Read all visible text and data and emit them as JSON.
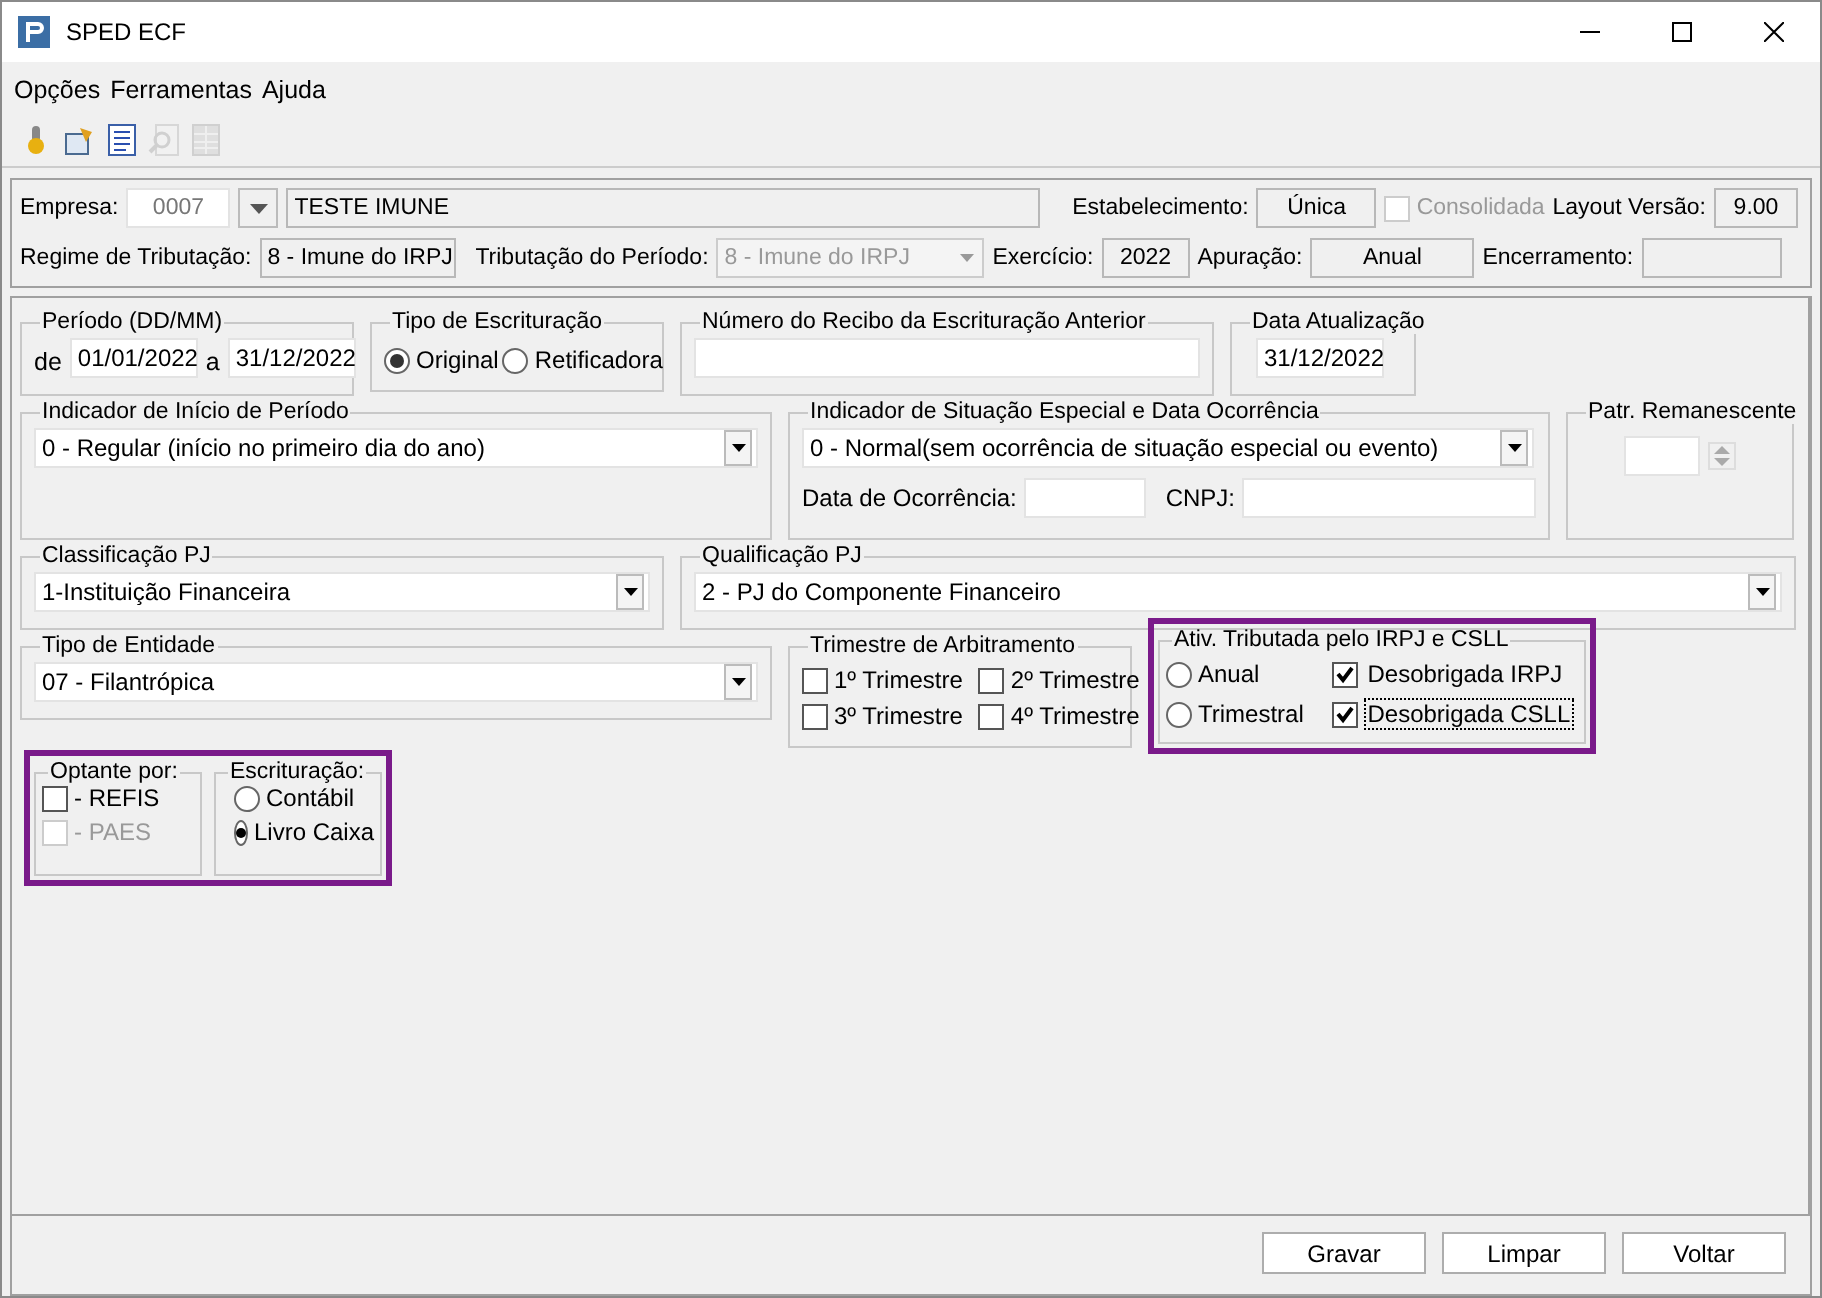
{
  "window": {
    "title": "SPED ECF"
  },
  "menu": [
    {
      "label": "Opções"
    },
    {
      "label": "Ferramentas"
    },
    {
      "label": "Ajuda"
    }
  ],
  "toolbar": [
    {
      "disabled": false
    },
    {
      "disabled": false
    },
    {
      "disabled": false
    },
    {
      "disabled": true
    },
    {
      "disabled": true
    }
  ],
  "header": {
    "empresa_label": "Empresa:",
    "empresa_code": "0007",
    "empresa_name": "TESTE IMUNE",
    "estabelecimento_label": "Estabelecimento:",
    "estabelecimento": "Única",
    "consolidada": {
      "label": "Consolidada",
      "checked": false,
      "disabled": true
    },
    "layout_label": "Layout Versão:",
    "layout": "9.00",
    "regime_label": "Regime de Tributação:",
    "regime": "8 - Imune do IRPJ",
    "tributacao_label": "Tributação do Período:",
    "tributacao": {
      "value": "8 - Imune do IRPJ",
      "disabled": true
    },
    "exercicio_label": "Exercício:",
    "exercicio": "2022",
    "apuracao_label": "Apuração:",
    "apuracao": "Anual",
    "encerramento_label": "Encerramento:"
  },
  "periodo": {
    "title": "Período (DD/MM)",
    "from_label": "de",
    "from": "01/01/2022",
    "to_label": "a",
    "to": "31/12/2022"
  },
  "tipo_escrituracao": {
    "title": "Tipo de Escrituração",
    "options": [
      {
        "label": "Original",
        "selected": true
      },
      {
        "label": "Retificadora",
        "selected": false
      }
    ]
  },
  "recibo": {
    "title": "Número do Recibo da Escrituração Anterior"
  },
  "data_atualizacao": {
    "title": "Data Atualização",
    "value": "31/12/2022"
  },
  "indicador_inicio": {
    "title": "Indicador de Início de Período",
    "value": "0 - Regular (início no primeiro dia do ano)"
  },
  "situacao_especial": {
    "title": "Indicador de Situação Especial e Data Ocorrência",
    "value": "0 - Normal(sem ocorrência de situação especial ou evento)",
    "data_label": "Data de Ocorrência:",
    "cnpj_label": "CNPJ:"
  },
  "patr": {
    "title": "Patr. Remanescente"
  },
  "classificacao": {
    "title": "Classificação PJ",
    "value": "1-Instituição Financeira"
  },
  "qualificacao": {
    "title": "Qualificação PJ",
    "value": "2 - PJ do Componente Financeiro"
  },
  "tipo_entidade": {
    "title": "Tipo de Entidade",
    "value": "07 - Filantrópica"
  },
  "trimestre": {
    "title": "Trimestre de Arbitramento",
    "options": [
      {
        "label": "1º Trimestre",
        "checked": false
      },
      {
        "label": "2º Trimestre",
        "checked": false
      },
      {
        "label": "3º Trimestre",
        "checked": false
      },
      {
        "label": "4º Trimestre",
        "checked": false
      }
    ]
  },
  "ativ": {
    "title": "Ativ. Tributada pelo IRPJ e CSLL",
    "highlighted": true,
    "periods": [
      {
        "label": "Anual",
        "selected": false
      },
      {
        "label": "Trimestral",
        "selected": false
      }
    ],
    "flags": [
      {
        "label": "Desobrigada IRPJ",
        "checked": true,
        "focused": false
      },
      {
        "label": "Desobrigada CSLL",
        "checked": true,
        "focused": true
      }
    ]
  },
  "opcoes": {
    "highlighted": true,
    "optante": {
      "title": "Optante por:",
      "items": [
        {
          "label": "- REFIS",
          "checked": false,
          "disabled": false
        },
        {
          "label": "- PAES",
          "checked": false,
          "disabled": true
        }
      ]
    },
    "escrituracao": {
      "title": "Escrituração:",
      "options": [
        {
          "label": "Contábil",
          "selected": false
        },
        {
          "label": "Livro Caixa",
          "selected": true
        }
      ]
    }
  },
  "buttons": [
    {
      "label": "Gravar"
    },
    {
      "label": "Limpar"
    },
    {
      "label": "Voltar"
    }
  ]
}
